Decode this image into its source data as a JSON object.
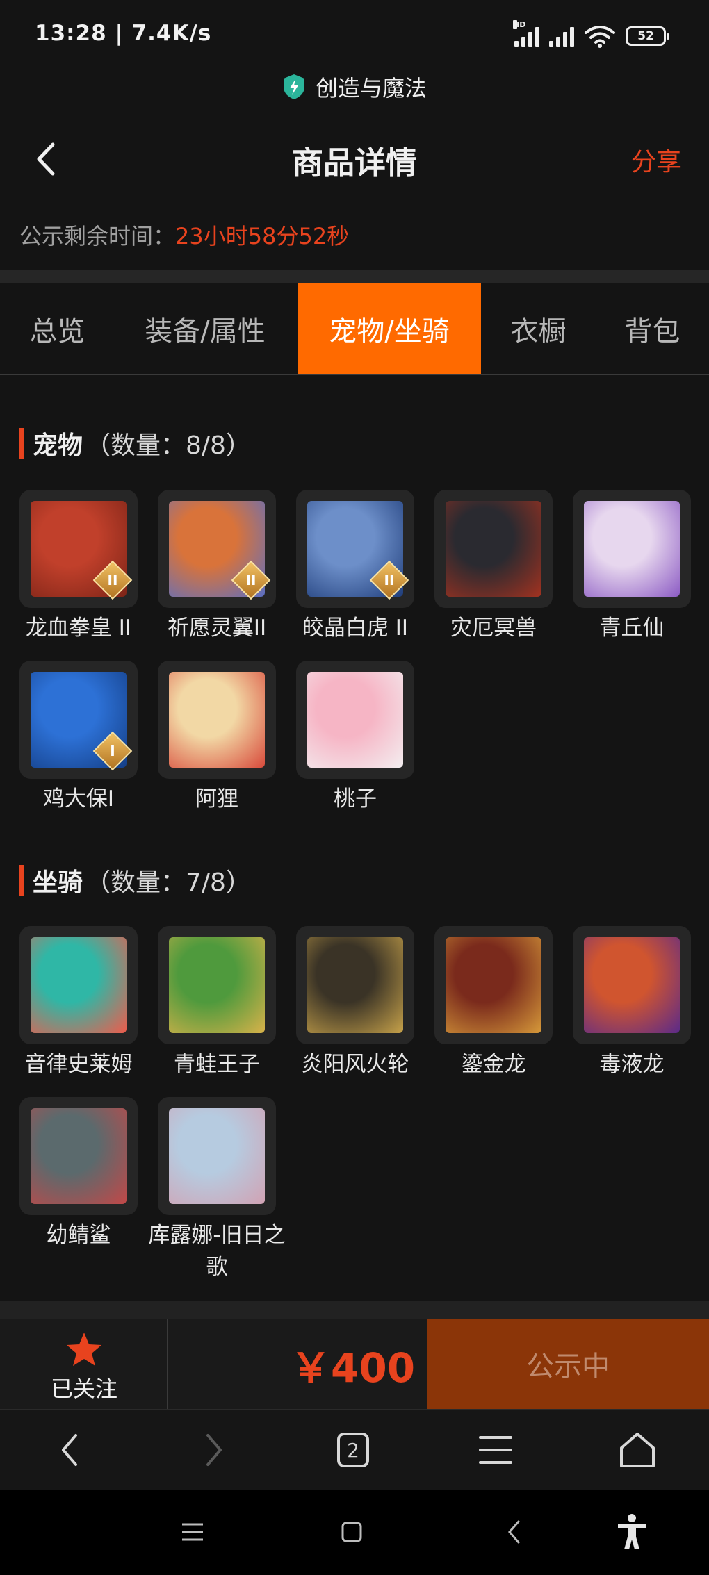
{
  "status_bar": {
    "time": "13:28 | 7.4K/s",
    "signal_badge": "HD",
    "battery": "52"
  },
  "app_badge": {
    "name": "创造与魔法",
    "icon": "shield-bolt-icon"
  },
  "header": {
    "title": "商品详情",
    "share_label": "分享",
    "back_icon": "chevron-left-icon"
  },
  "countdown": {
    "label": "公示剩余时间：",
    "value": "23小时58分52秒"
  },
  "tabs": [
    {
      "label": "总览",
      "active": false
    },
    {
      "label": "装备/属性",
      "active": false
    },
    {
      "label": "宠物/坐骑",
      "active": true
    },
    {
      "label": "衣橱",
      "active": false
    },
    {
      "label": "背包",
      "active": false
    }
  ],
  "pets": {
    "title": "宠物",
    "count": "（数量：8/8）",
    "items": [
      {
        "name": "龙血拳皇 II",
        "badge": "II",
        "colors": [
          "#c1402b",
          "#7d2417"
        ]
      },
      {
        "name": "祈愿灵翼II",
        "badge": "II",
        "colors": [
          "#d9733a",
          "#5a6fc4"
        ]
      },
      {
        "name": "皎晶白虎 II",
        "badge": "II",
        "colors": [
          "#6d8fc9",
          "#1f3d7a"
        ]
      },
      {
        "name": "灾厄冥兽",
        "badge": "",
        "colors": [
          "#2a2a30",
          "#a33220"
        ]
      },
      {
        "name": "青丘仙",
        "badge": "",
        "colors": [
          "#e7d7ee",
          "#8c5bc4"
        ]
      },
      {
        "name": "鸡大保I",
        "badge": "I",
        "colors": [
          "#2d71d6",
          "#143e86"
        ]
      },
      {
        "name": "阿狸",
        "badge": "",
        "colors": [
          "#f2d8a5",
          "#d84a3b"
        ]
      },
      {
        "name": "桃子",
        "badge": "",
        "colors": [
          "#f6b5c5",
          "#f3eef0"
        ]
      }
    ]
  },
  "mounts": {
    "title": "坐骑",
    "count": "（数量：7/8）",
    "items": [
      {
        "name": "音律史莱姆",
        "badge": "",
        "colors": [
          "#2fb7a6",
          "#ef5b4b"
        ]
      },
      {
        "name": "青蛙王子",
        "badge": "",
        "colors": [
          "#4f9a3d",
          "#d9b24a"
        ]
      },
      {
        "name": "炎阳风火轮",
        "badge": "",
        "colors": [
          "#3a3326",
          "#c7a24a"
        ]
      },
      {
        "name": "鎏金龙",
        "badge": "",
        "colors": [
          "#7a2a1c",
          "#d79a3a"
        ]
      },
      {
        "name": "毒液龙",
        "badge": "",
        "colors": [
          "#d0552f",
          "#5a2a8a"
        ]
      },
      {
        "name": "幼鲭鲨",
        "badge": "",
        "colors": [
          "#5b6a6d",
          "#c24848"
        ]
      },
      {
        "name": "库露娜-旧日之歌",
        "badge": "",
        "colors": [
          "#b6cbe0",
          "#d1a2b3"
        ]
      }
    ]
  },
  "action_bar": {
    "follow_label": "已关注",
    "follow_icon": "star-icon",
    "price": "￥400",
    "status_label": "公示中"
  },
  "browser_nav": {
    "tab_count": "2"
  },
  "colors": {
    "accent": "#e8431e",
    "tab_active": "#ff6a00",
    "status_button": "#8b3508"
  }
}
